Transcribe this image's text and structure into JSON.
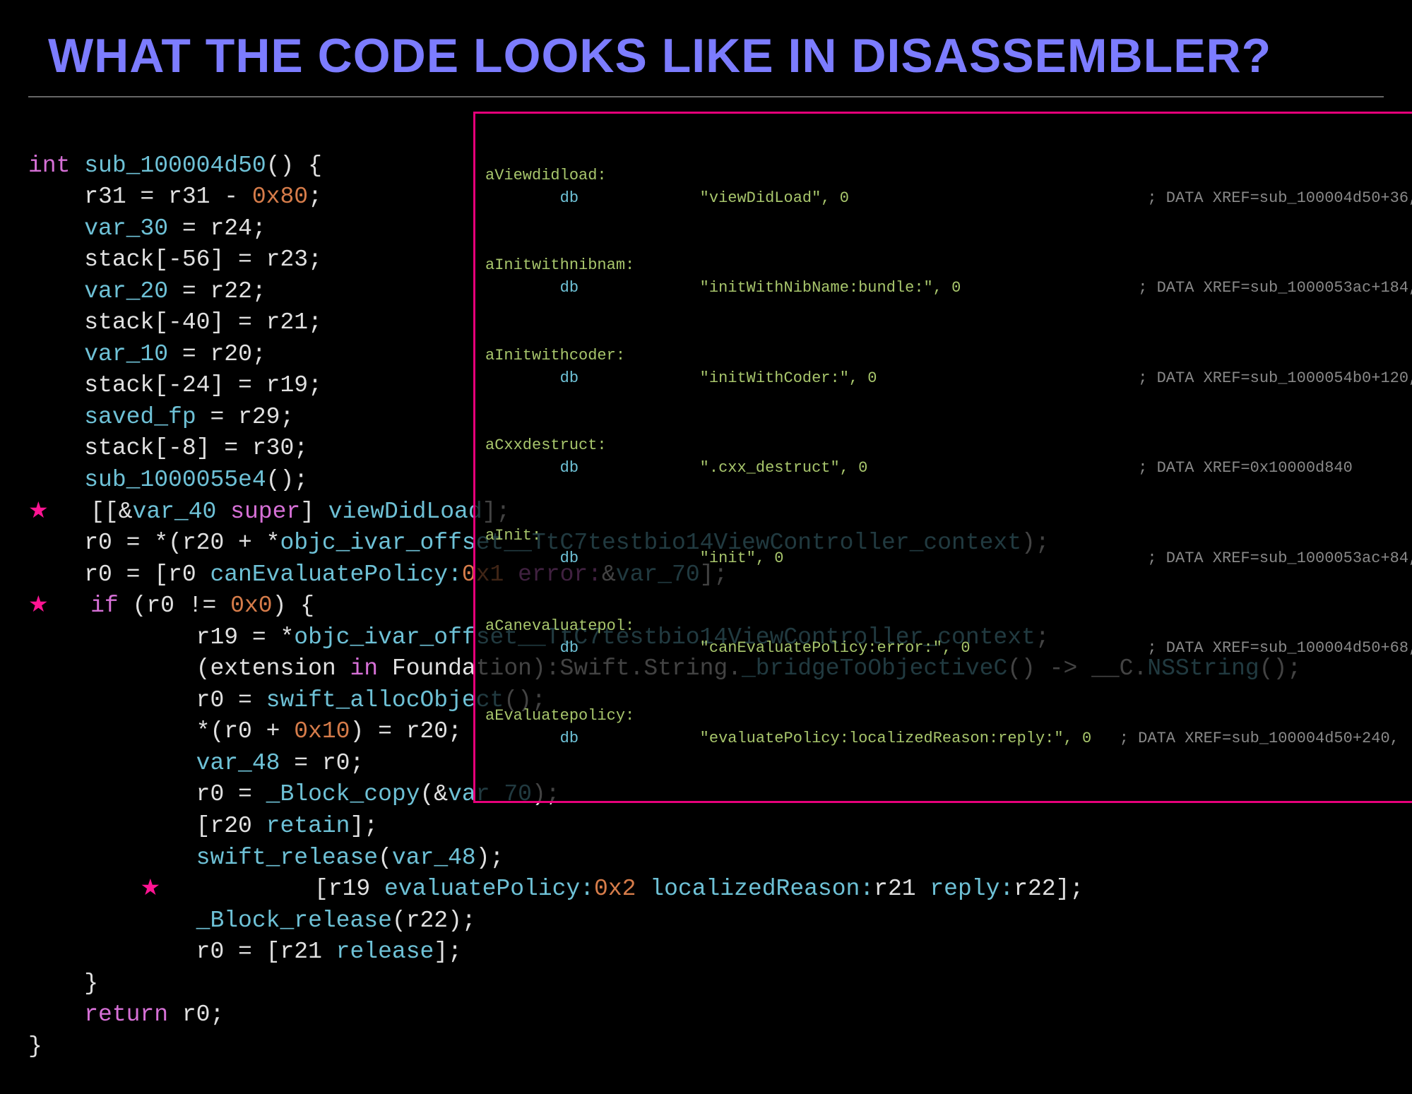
{
  "title": "WHAT THE CODE LOOKS LIKE IN DISASSEMBLER?",
  "strings_box": {
    "rows": [
      {
        "label": "aViewdidload:",
        "db": "db",
        "value": "\"viewDidLoad\", 0",
        "xref": "; DATA XREF=sub_100004d50+36,"
      },
      {
        "label": "aInitwithnibnam:",
        "db": "db",
        "value": "\"initWithNibName:bundle:\", 0",
        "xref": "; DATA XREF=sub_1000053ac+184,"
      },
      {
        "label": "aInitwithcoder:",
        "db": "db",
        "value": "\"initWithCoder:\", 0",
        "xref": "; DATA XREF=sub_1000054b0+120,"
      },
      {
        "label": "aCxxdestruct:",
        "db": "db",
        "value": "\".cxx_destruct\", 0",
        "xref": "; DATA XREF=0x10000d840"
      },
      {
        "label": "aInit:",
        "db": "db",
        "value": "\"init\", 0",
        "xref": "; DATA XREF=sub_1000053ac+84,"
      },
      {
        "label": "aCanevaluatepol:",
        "db": "db",
        "value": "\"canEvaluatePolicy:error:\", 0",
        "xref": "; DATA XREF=sub_100004d50+68,"
      },
      {
        "label": "aEvaluatepolicy:",
        "db": "db",
        "value": "\"evaluatePolicy:localizedReason:reply:\", 0",
        "xref": "; DATA XREF=sub_100004d50+240,"
      }
    ]
  },
  "code": {
    "l1_int": "int",
    "l1_fn": "sub_100004d50",
    "l1_rest": "() {",
    "l2": "    r31 = r31 - ",
    "l2_hex": "0x80",
    "l2_end": ";",
    "l3_var": "    var_30",
    "l3_rest": " = r24;",
    "l4": "    stack[-56] = r23;",
    "l5_var": "    var_20",
    "l5_rest": " = r22;",
    "l6": "    stack[-40] = r21;",
    "l7_var": "    var_10",
    "l7_rest": " = r20;",
    "l8": "    stack[-24] = r19;",
    "l9_var": "    saved_fp",
    "l9_rest": " = r29;",
    "l10": "    stack[-8] = r30;",
    "l11_fn": "    sub_1000055e4",
    "l11_rest": "();",
    "l12a": "   [[&",
    "l12_var": "var_40",
    "l12b": " ",
    "l12_super": "super",
    "l12c": "] ",
    "l12_msg": "viewDidLoad",
    "l12d": "];",
    "l13a": "    r0 = *(r20 + *",
    "l13_sym": "objc_ivar_offset__TtC7testbio14ViewController_context",
    "l13b": ");",
    "l14a": "    r0 = [r0 ",
    "l14_msg": "canEvaluatePolicy:",
    "l14_hex": "0x1",
    "l14b": " ",
    "l14_err": "error:",
    "l14c": "&",
    "l14_var": "var_70",
    "l14d": "];",
    "l15_if": "   if",
    "l15a": " (r0 != ",
    "l15_hex": "0x0",
    "l15b": ") {",
    "l16a": "            r19 = *",
    "l16_sym": "objc_ivar_offset__TtC7testbio14ViewController_context",
    "l16b": ";",
    "l17a": "            (extension ",
    "l17_in": "in",
    "l17b": " Foundation):Swift.String.",
    "l17_fn": "_bridgeToObjectiveC",
    "l17c": "() -> __C.",
    "l17_fn2": "NSString",
    "l17d": "();",
    "l18a": "            r0 = ",
    "l18_fn": "swift_allocObject",
    "l18b": "();",
    "l19a": "            *(r0 + ",
    "l19_hex": "0x10",
    "l19b": ") = r20;",
    "l20_var": "            var_48",
    "l20_rest": " = r0;",
    "l21a": "            r0 = ",
    "l21_fn": "_Block_copy",
    "l21b": "(&",
    "l21_var": "var_70",
    "l21c": ");",
    "l22a": "            [r20 ",
    "l22_msg": "retain",
    "l22b": "];",
    "l23a": "            ",
    "l23_fn": "swift_release",
    "l23b": "(",
    "l23_var": "var_48",
    "l23c": ");",
    "l24a": "           [r19 ",
    "l24_msg1": "evaluatePolicy:",
    "l24_hex": "0x2",
    "l24b": " ",
    "l24_msg2": "localizedReason:",
    "l24c": "r21 ",
    "l24_msg3": "reply:",
    "l24d": "r22];",
    "l25a": "            ",
    "l25_fn": "_Block_release",
    "l25b": "(r22);",
    "l26a": "            r0 = [r21 ",
    "l26_msg": "release",
    "l26b": "];",
    "l27": "    }",
    "l28_ret": "    return",
    "l28_rest": " r0;",
    "l29": "}"
  },
  "star": "★"
}
